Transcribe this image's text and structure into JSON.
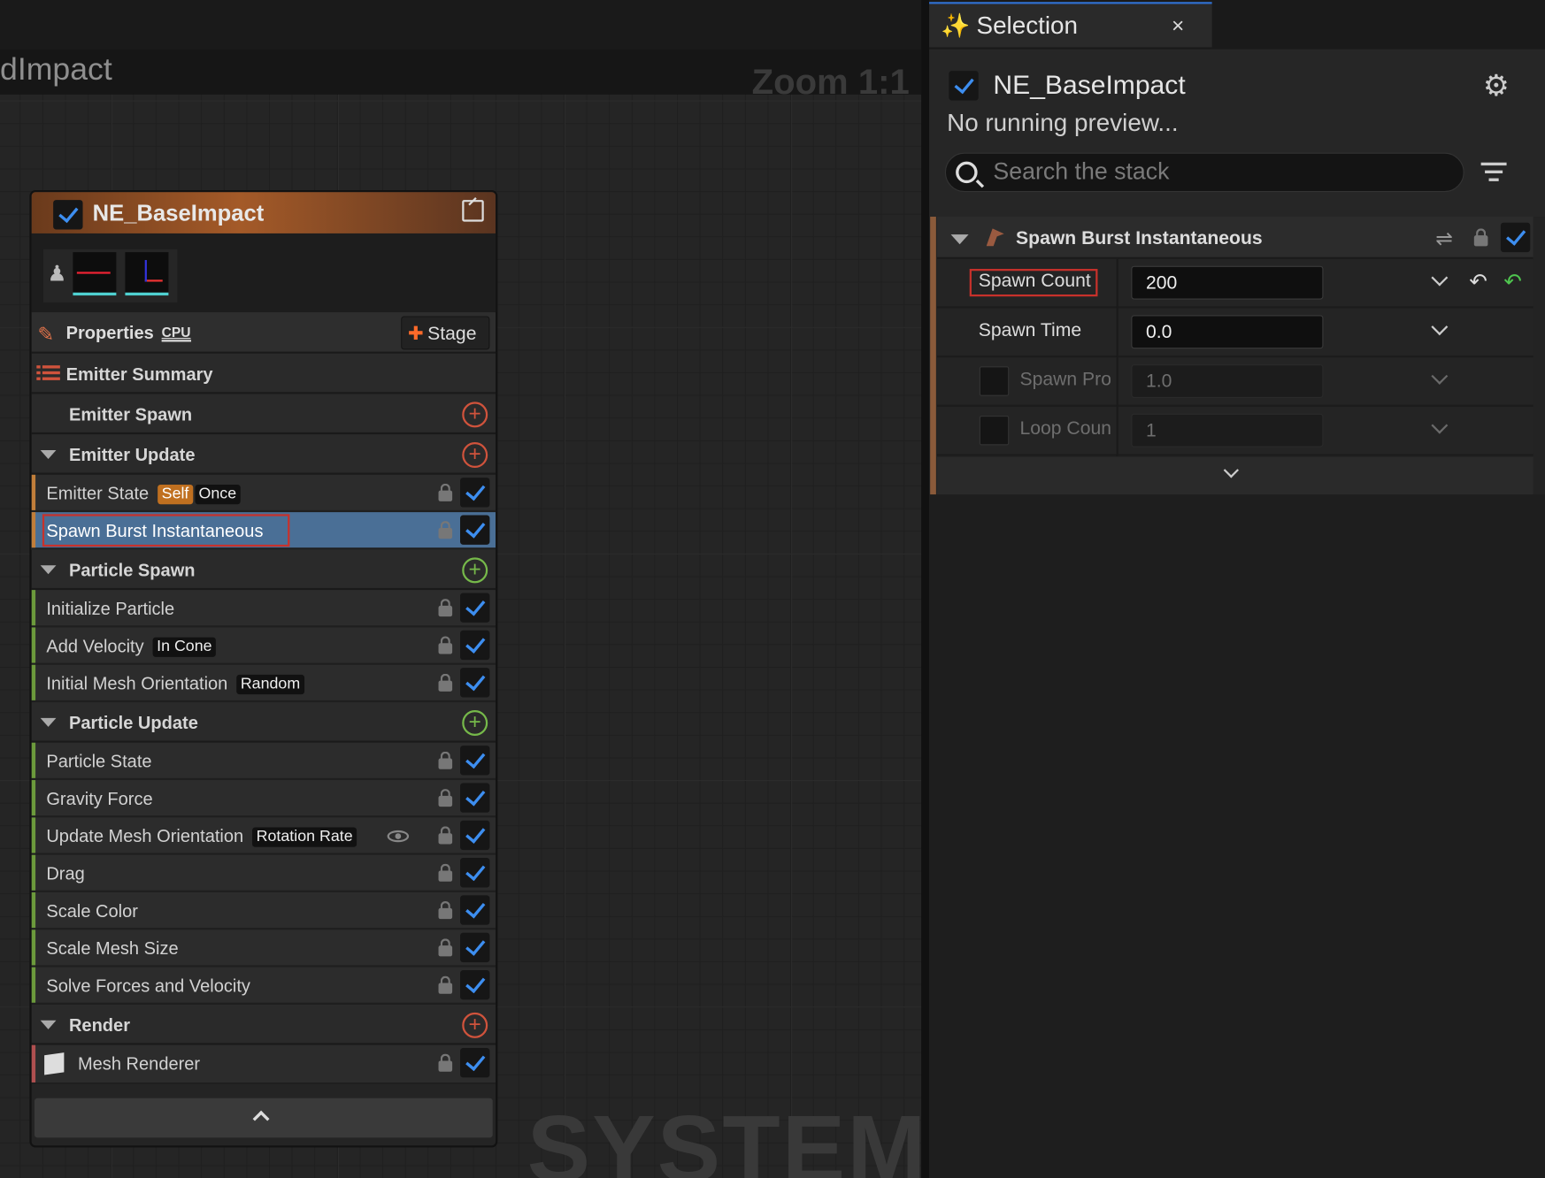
{
  "graph": {
    "title": "dImpact",
    "zoom": "Zoom 1:1",
    "watermark": "SYSTEM"
  },
  "node": {
    "title": "NE_BaseImpact",
    "properties_label": "Properties",
    "sim_target": "CPU",
    "stage_button": "Stage",
    "sections": {
      "emitter_summary": "Emitter Summary",
      "emitter_spawn": "Emitter Spawn",
      "emitter_update": "Emitter Update",
      "particle_spawn": "Particle Spawn",
      "particle_update": "Particle Update",
      "render": "Render"
    },
    "modules": {
      "emitter_state": {
        "label": "Emitter State",
        "tag1": "Self",
        "tag2": "Once"
      },
      "spawn_burst": {
        "label": "Spawn Burst Instantaneous"
      },
      "initialize_particle": {
        "label": "Initialize Particle"
      },
      "add_velocity": {
        "label": "Add Velocity",
        "tag": "In Cone"
      },
      "initial_mesh_orientation": {
        "label": "Initial Mesh Orientation",
        "tag": "Random"
      },
      "particle_state": {
        "label": "Particle State"
      },
      "gravity_force": {
        "label": "Gravity Force"
      },
      "update_mesh_orientation": {
        "label": "Update Mesh Orientation",
        "tag": "Rotation Rate"
      },
      "drag": {
        "label": "Drag"
      },
      "scale_color": {
        "label": "Scale Color"
      },
      "scale_mesh_size": {
        "label": "Scale Mesh Size"
      },
      "solve_forces": {
        "label": "Solve Forces and Velocity"
      },
      "mesh_renderer": {
        "label": "Mesh Renderer"
      }
    }
  },
  "selection": {
    "tab_title": "Selection",
    "close_glyph": "×",
    "emitter_name": "NE_BaseImpact",
    "preview_status": "No running preview...",
    "search_placeholder": "Search the stack",
    "module_title": "Spawn Burst Instantaneous",
    "params": [
      {
        "name": "Spawn Count",
        "value": "200",
        "enabled": true
      },
      {
        "name": "Spawn Time",
        "value": "0.0",
        "enabled": true
      },
      {
        "name": "Spawn Pro",
        "value": "1.0",
        "enabled": false
      },
      {
        "name": "Loop Coun",
        "value": "1",
        "enabled": false
      }
    ]
  },
  "colors": {
    "accent": "#3d8ef0",
    "emitter_header": "#a45a28",
    "selected_row": "#4a6f96",
    "highlight_box": "#c8312b",
    "emitter_stage_bar": "#c17e3a",
    "particle_stage_bar": "#6c9a3c",
    "render_stage_bar": "#b05050",
    "reset_green": "#4fc64f"
  },
  "icons": [
    "checkmark-icon",
    "popout-icon",
    "person-icon",
    "pencil-icon",
    "list-icon",
    "plus-circle-icon",
    "triangle-down-icon",
    "lock-icon",
    "eye-icon",
    "cube-icon",
    "chevron-up-icon",
    "sparkle-icon",
    "close-icon",
    "gear-icon",
    "search-icon",
    "filter-icon",
    "shuffle-icon",
    "chevron-down-icon",
    "undo-icon",
    "reset-icon"
  ]
}
